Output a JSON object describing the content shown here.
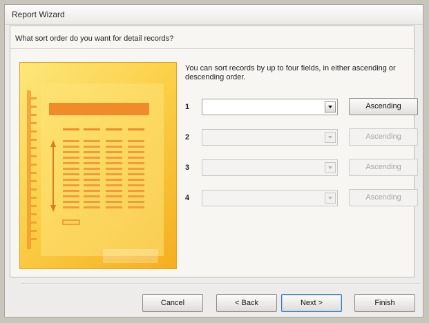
{
  "window": {
    "title": "Report Wizard"
  },
  "question": "What sort order do you want for detail records?",
  "instructions": "You can sort records by up to four fields, in either ascending or descending order.",
  "sort_rows": [
    {
      "number": "1",
      "field_value": "",
      "order_label": "Ascending",
      "enabled": true
    },
    {
      "number": "2",
      "field_value": "",
      "order_label": "Ascending",
      "enabled": false
    },
    {
      "number": "3",
      "field_value": "",
      "order_label": "Ascending",
      "enabled": false
    },
    {
      "number": "4",
      "field_value": "",
      "order_label": "Ascending",
      "enabled": false
    }
  ],
  "buttons": {
    "cancel": "Cancel",
    "back": "< Back",
    "next": "Next >",
    "finish": "Finish"
  },
  "colors": {
    "illustration_bg": "#fbd048",
    "illustration_bar": "#f08a2a",
    "default_button_border": "#3d7bbd"
  },
  "icons": {
    "combo_arrow": "chevron-down-icon",
    "illustration": "report-preview-icon"
  }
}
